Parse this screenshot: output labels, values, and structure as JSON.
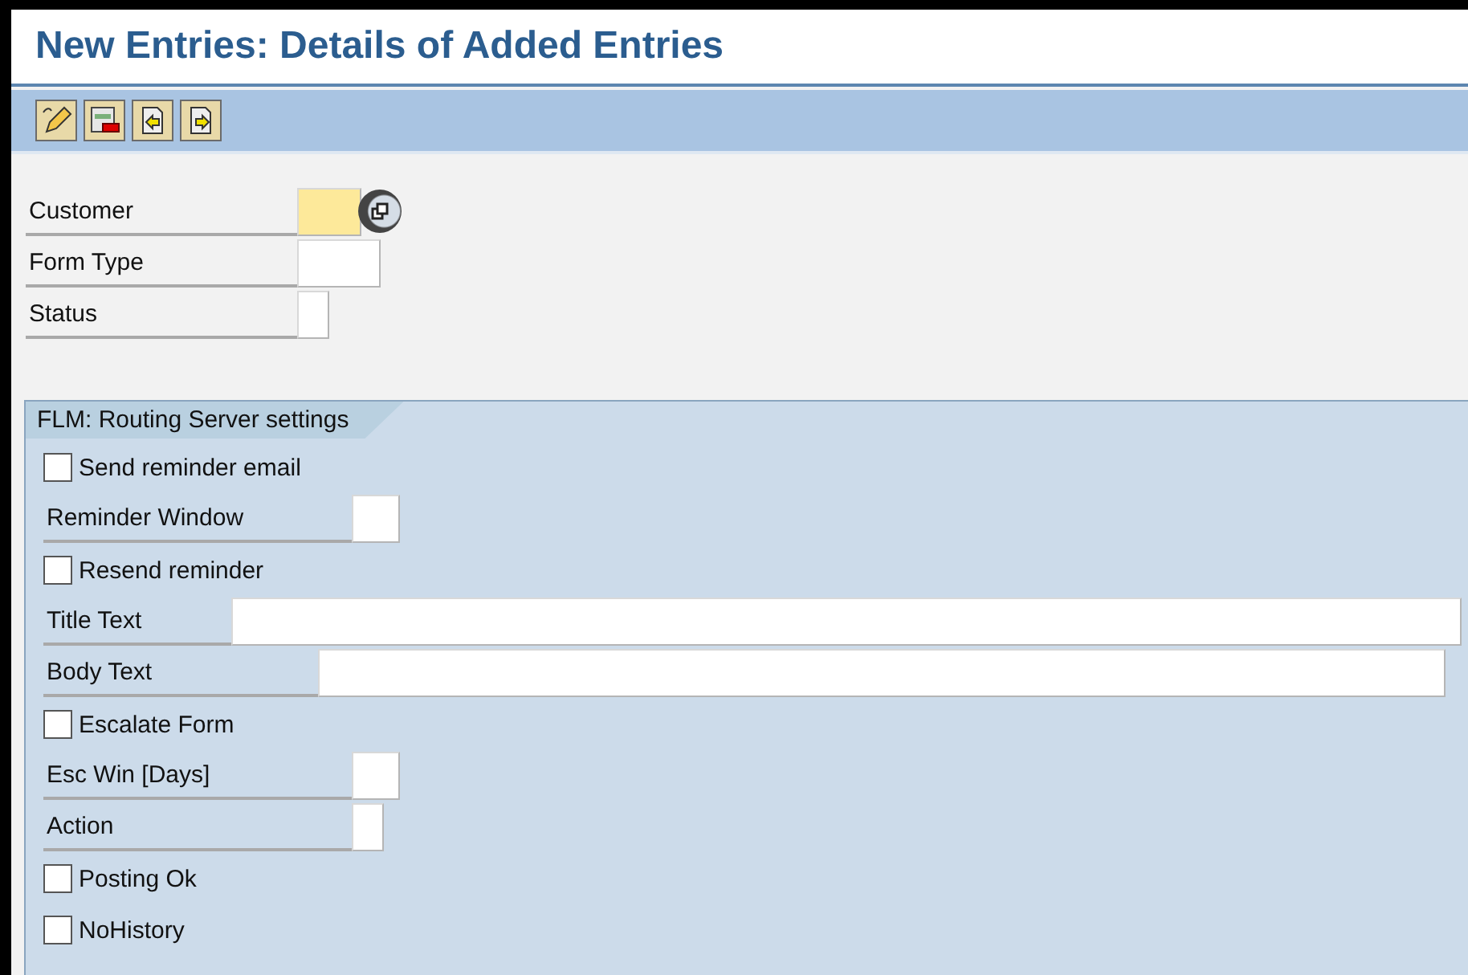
{
  "window": {
    "title": "New Entries: Details of Added Entries"
  },
  "toolbar": {
    "buttons": [
      {
        "kind": "edit"
      },
      {
        "kind": "delete"
      },
      {
        "kind": "previous"
      },
      {
        "kind": "next"
      }
    ]
  },
  "header_fields": [
    {
      "label": "Customer",
      "required": true,
      "search_help": true
    },
    {
      "label": "Form Type",
      "required": false,
      "search_help": false
    },
    {
      "label": "Status",
      "required": false,
      "search_help": false
    }
  ],
  "group": {
    "title": "FLM: Routing Server settings",
    "rows": [
      {
        "kind": "checkbox",
        "label": "Send reminder email",
        "checked": false
      },
      {
        "kind": "field",
        "label": "Reminder Window"
      },
      {
        "kind": "checkbox",
        "label": "Resend reminder",
        "checked": false
      },
      {
        "kind": "field",
        "label": "Title Text"
      },
      {
        "kind": "field",
        "label": "Body Text"
      },
      {
        "kind": "checkbox",
        "label": "Escalate Form",
        "checked": false
      },
      {
        "kind": "field",
        "label": "Esc Win [Days]"
      },
      {
        "kind": "field",
        "label": "Action"
      },
      {
        "kind": "checkbox",
        "label": "Posting Ok",
        "checked": false
      },
      {
        "kind": "checkbox",
        "label": "NoHistory",
        "checked": false
      }
    ]
  }
}
